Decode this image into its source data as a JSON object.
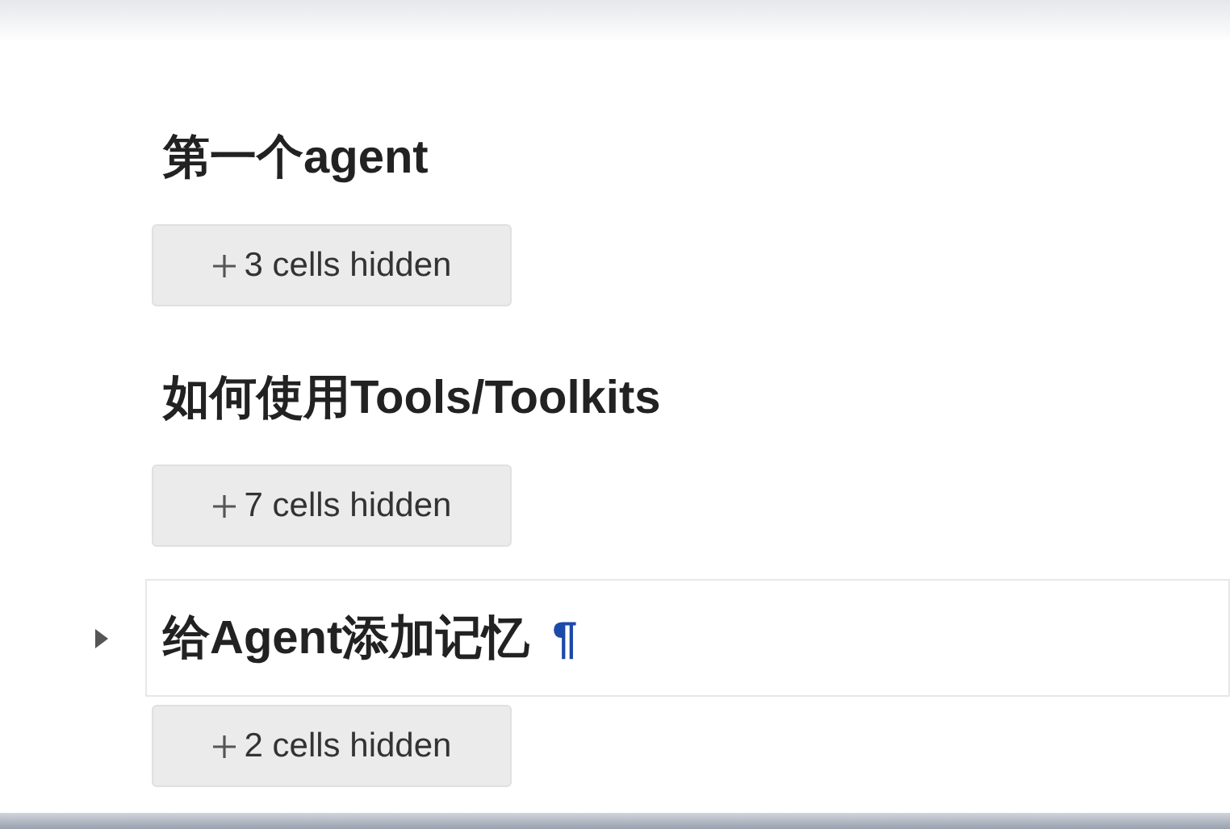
{
  "sections": [
    {
      "heading": "第一个agent",
      "selected": false,
      "hidden_button": "3 cells hidden"
    },
    {
      "heading": "如何使用Tools/Toolkits",
      "selected": false,
      "hidden_button": "7 cells hidden"
    },
    {
      "heading": "给Agent添加记忆",
      "selected": true,
      "anchor": "¶",
      "hidden_button": "2 cells hidden"
    }
  ]
}
